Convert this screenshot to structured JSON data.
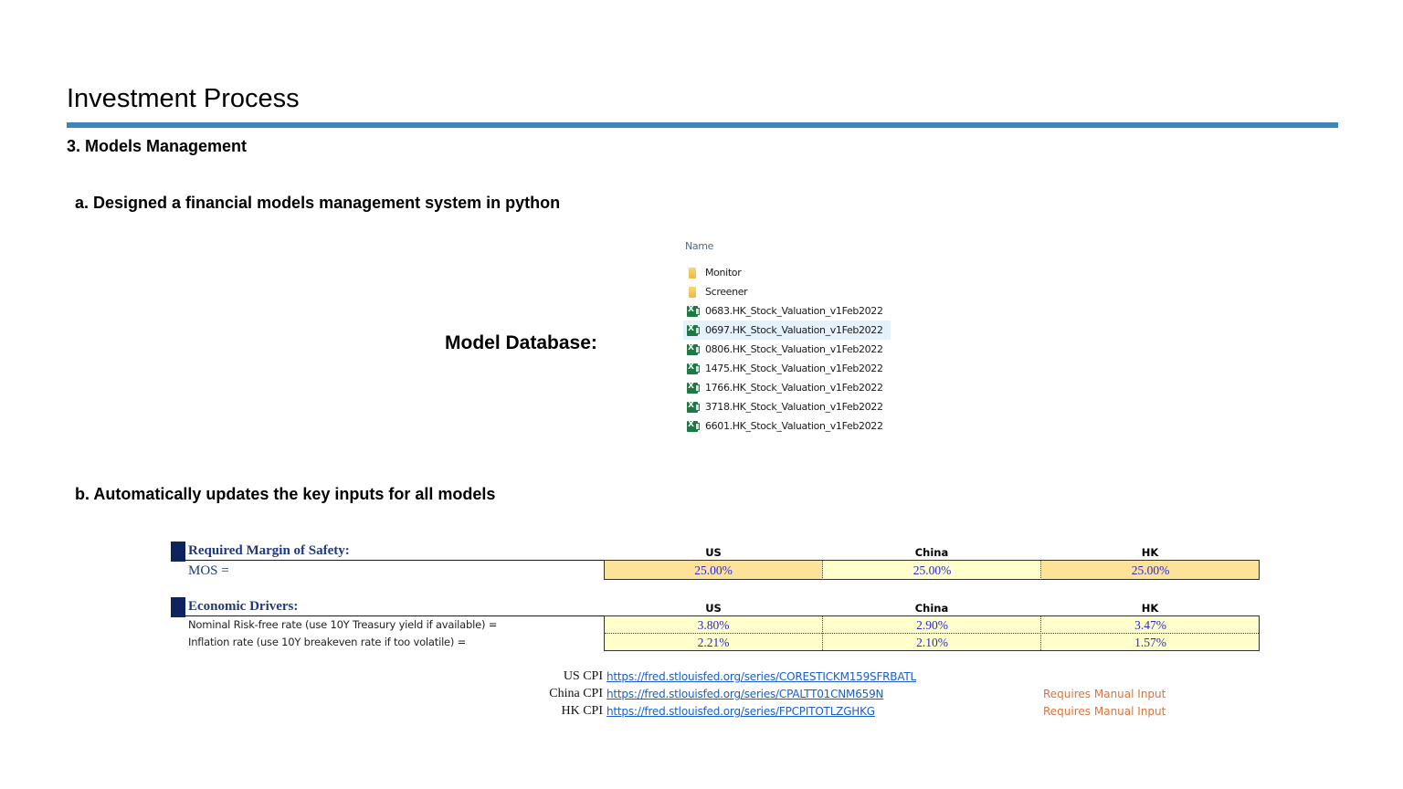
{
  "page": {
    "title": "Investment Process",
    "section_heading": "3. Models Management",
    "sub_a": "a. Designed a financial models management system in python",
    "sub_b": "b. Automatically updates the key inputs for all models",
    "model_db_label": "Model Database:"
  },
  "file_panel": {
    "header": "Name",
    "files": [
      {
        "name": "Monitor",
        "type": "folder",
        "selected": false
      },
      {
        "name": "Screener",
        "type": "folder",
        "selected": false
      },
      {
        "name": "0683.HK_Stock_Valuation_v1Feb2022",
        "type": "excel",
        "selected": false
      },
      {
        "name": "0697.HK_Stock_Valuation_v1Feb2022",
        "type": "excel",
        "selected": true
      },
      {
        "name": "0806.HK_Stock_Valuation_v1Feb2022",
        "type": "excel",
        "selected": false
      },
      {
        "name": "1475.HK_Stock_Valuation_v1Feb2022",
        "type": "excel",
        "selected": false
      },
      {
        "name": "1766.HK_Stock_Valuation_v1Feb2022",
        "type": "excel",
        "selected": false
      },
      {
        "name": "3718.HK_Stock_Valuation_v1Feb2022",
        "type": "excel",
        "selected": false
      },
      {
        "name": "6601.HK_Stock_Valuation_v1Feb2022",
        "type": "excel",
        "selected": false
      }
    ]
  },
  "mos_table": {
    "title": "Required Margin of Safety:",
    "columns": [
      "US",
      "China",
      "HK"
    ],
    "row_label": "MOS =",
    "values": [
      "25.00%",
      "25.00%",
      "25.00%"
    ]
  },
  "drivers_table": {
    "title": "Economic Drivers:",
    "columns": [
      "US",
      "China",
      "HK"
    ],
    "rows": [
      {
        "label": "Nominal Risk-free rate  (use 10Y Treasury yield if available) =",
        "values": [
          "3.80%",
          "2.90%",
          "3.47%"
        ]
      },
      {
        "label": "Inflation rate (use 10Y breakeven rate if too volatile) =",
        "values": [
          "2.21%",
          "2.10%",
          "1.57%"
        ]
      }
    ]
  },
  "cpi_links": [
    {
      "label": "US CPI",
      "url": "https://fred.stlouisfed.org/series/CORESTICKM159SFRBATL",
      "note": ""
    },
    {
      "label": "China CPI",
      "url": "https://fred.stlouisfed.org/series/CPALTT01CNM659N",
      "note": "Requires Manual Input"
    },
    {
      "label": "HK CPI",
      "url": "https://fred.stlouisfed.org/series/FPCPITOTLZGHKG",
      "note": "Requires Manual Input"
    }
  ],
  "colors": {
    "accent_rule": "#3b86b8",
    "section_square": "#0f245e",
    "orange_cell": "#fde39a",
    "yellow_cell": "#ffffcc",
    "value_text": "#2a2ad0",
    "link": "#1a5fc8",
    "note": "#d9733a"
  }
}
